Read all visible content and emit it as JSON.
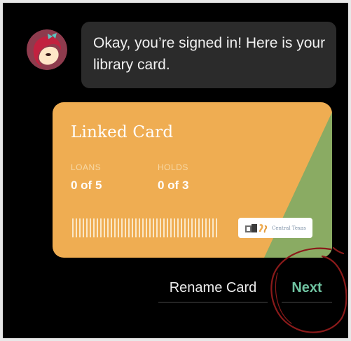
{
  "chat": {
    "message": "Okay, you’re signed in! Here is your library card."
  },
  "card": {
    "title": "Linked Card",
    "loans_label": "LOANS",
    "loans_value": "0 of 5",
    "holds_label": "HOLDS",
    "holds_value": "0 of 3",
    "library_name": "Central Texas",
    "colors": {
      "card": "#efad52",
      "stripe": "#8aab63"
    }
  },
  "actions": {
    "rename_label": "Rename Card",
    "next_label": "Next"
  },
  "colors": {
    "accent": "#6fc3a1",
    "annotation": "#8a1a1a"
  }
}
